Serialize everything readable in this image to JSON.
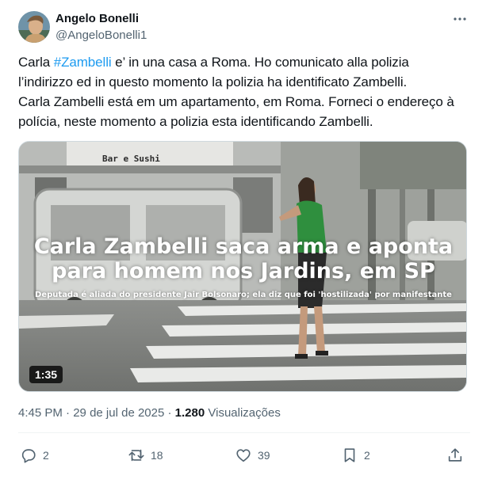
{
  "author": {
    "name": "Angelo Bonelli",
    "handle": "@AngeloBonelli1"
  },
  "tweet": {
    "line1_before": "Carla ",
    "hashtag": "#Zambelli",
    "line1_after": " e’ in una casa a Roma.  Ho comunicato alla polizia",
    "line2": "l’indirizzo ed  in questo momento la polizia ha identificato Zambelli.",
    "line3": "Carla Zambelli está em um apartamento, em Roma. Forneci o endereço à",
    "line4": "polícia, neste momento a polizia  esta identificando Zambelli."
  },
  "media": {
    "headline_line1": "Carla Zambelli saca arma e aponta",
    "headline_line2": "para homem nos Jardins, em SP",
    "subline": "Deputada é aliada do presidente Jair Bolsonaro; ela diz que foi 'hostilizada' por manifestante",
    "store_sign": "Bar e Sushi",
    "duration": "1:35"
  },
  "meta": {
    "time": "4:45 PM",
    "separator": " · ",
    "date": "29 de jul de 2025",
    "views_count": "1.280",
    "views_label": " Visualizações"
  },
  "actions": {
    "replies": "2",
    "reposts": "18",
    "likes": "39",
    "bookmarks": "2"
  },
  "icons": {
    "more": "more-horizontal-icon",
    "reply": "reply-icon",
    "repost": "repost-icon",
    "like": "heart-icon",
    "bookmark": "bookmark-icon",
    "share": "share-icon"
  },
  "colors": {
    "accent": "#1d9bf0",
    "text_primary": "#0f1419",
    "text_secondary": "#536471",
    "divider": "#eff3f4"
  }
}
